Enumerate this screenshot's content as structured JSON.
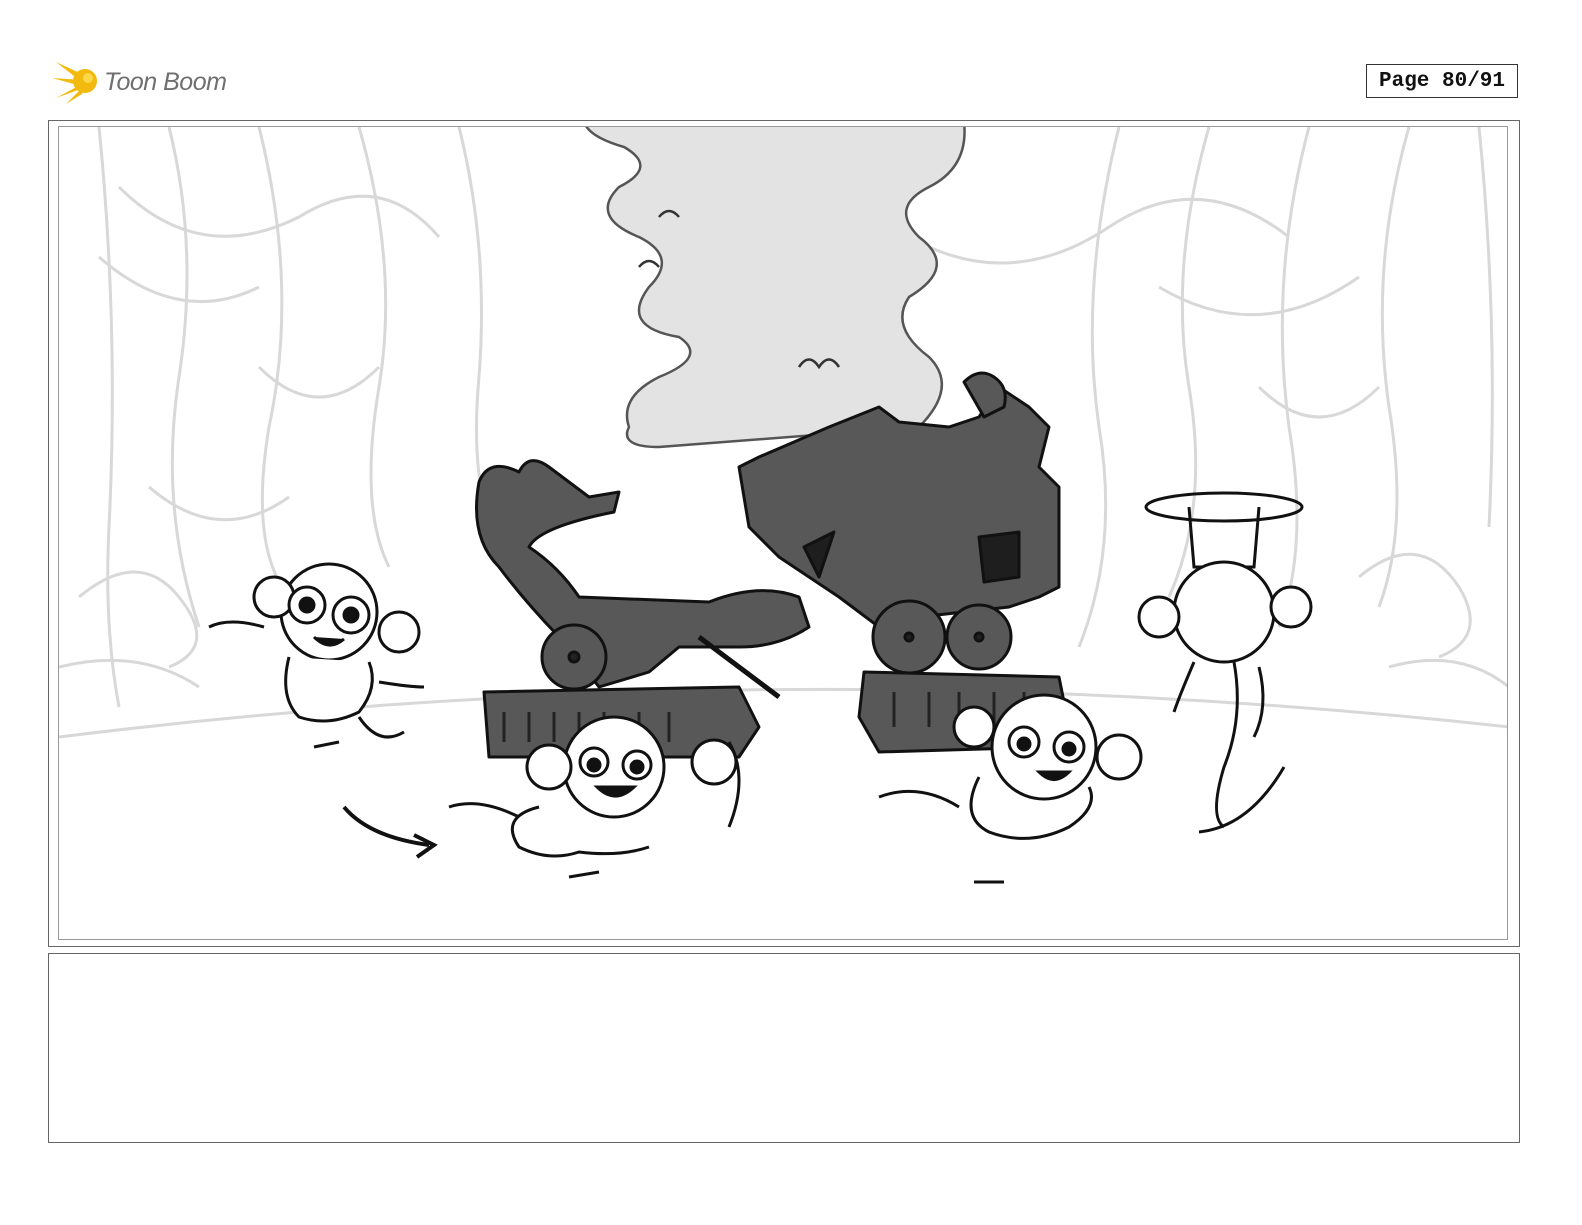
{
  "header": {
    "logo_text": "Toon Boom",
    "page_label": "Page 80/91",
    "logo_icon": "toon-boom-burst-icon"
  },
  "panel": {
    "drawing": "storyboard-sketch-illustration"
  },
  "notes": {
    "text": ""
  },
  "colors": {
    "logo_yellow": "#f2b90f",
    "cart_fill": "#585858",
    "smoke_fill": "#e3e3e3",
    "curtain_stroke": "#d6d6d6"
  }
}
